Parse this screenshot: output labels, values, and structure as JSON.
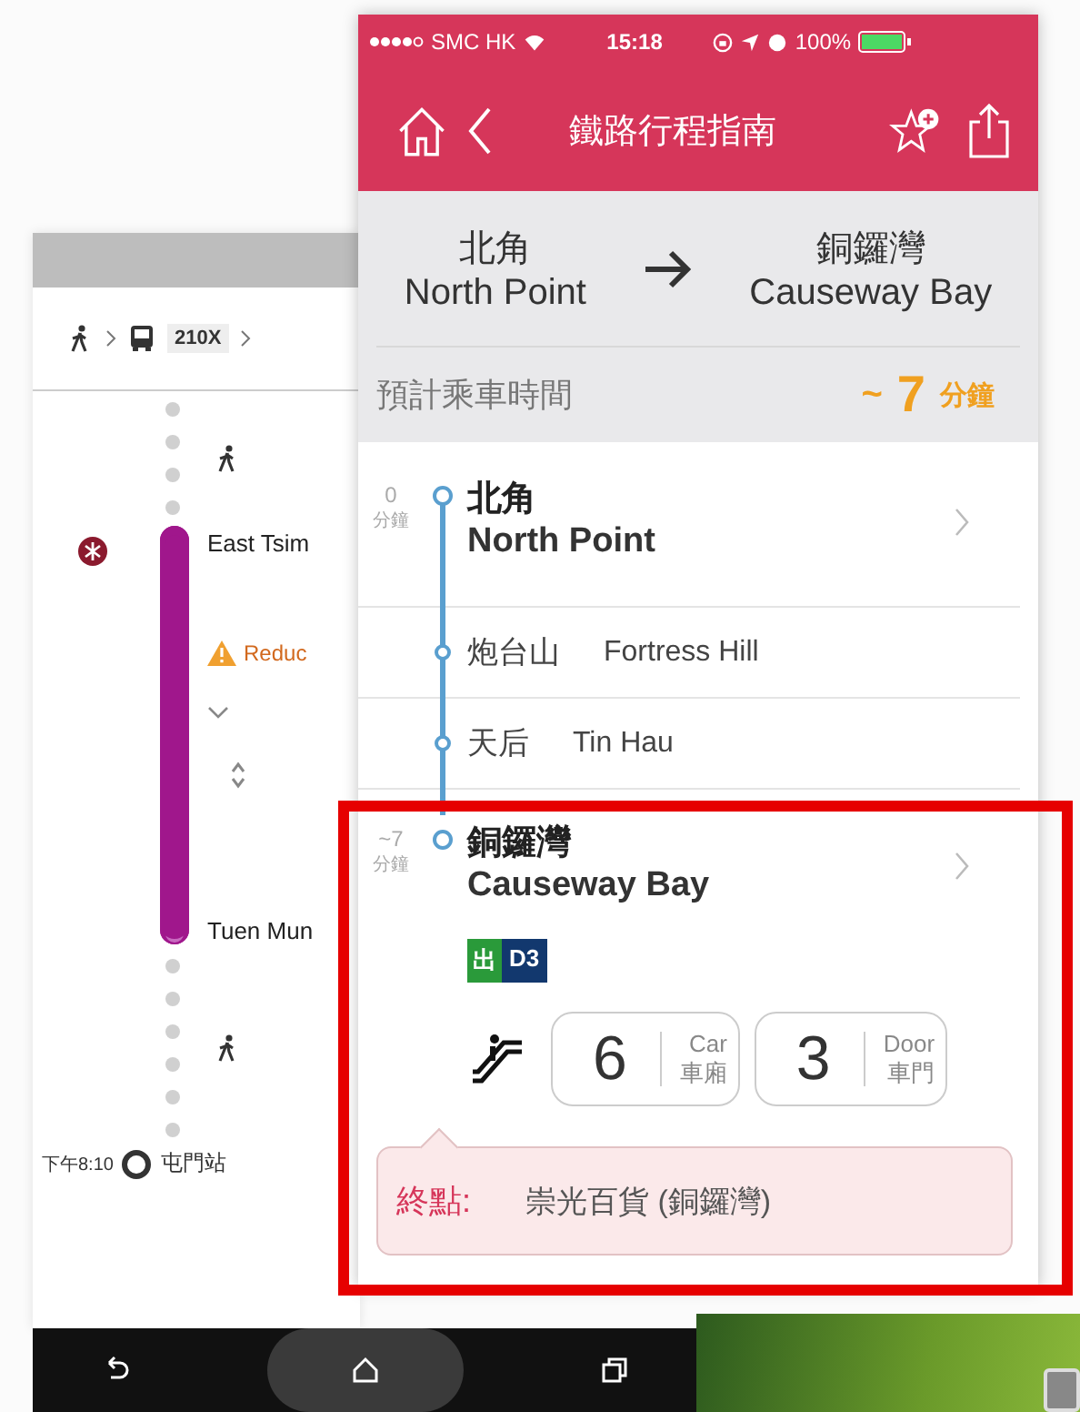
{
  "back_screen": {
    "route_bus": "210X",
    "stops": [
      {
        "kind": "station",
        "name": "East Tsim"
      },
      {
        "kind": "alert",
        "text": "Reduc"
      },
      {
        "kind": "station",
        "name": "Tuen Mun"
      },
      {
        "kind": "end",
        "time": "下午8:10",
        "name": "屯門站"
      }
    ]
  },
  "status_bar": {
    "carrier": "SMC HK",
    "time": "15:18",
    "battery": "100%"
  },
  "title": "鐵路行程指南",
  "route": {
    "from": {
      "zh": "北角",
      "en": "North Point"
    },
    "to": {
      "zh": "銅鑼灣",
      "en": "Causeway Bay"
    }
  },
  "travel_time": {
    "label": "預計乘車時間",
    "prefix": "~",
    "value": "7",
    "unit": "分鐘"
  },
  "stops": [
    {
      "kind": "major",
      "minutes": "0",
      "minutes_unit": "分鐘",
      "zh": "北角",
      "en": "North Point"
    },
    {
      "kind": "minor",
      "zh": "炮台山",
      "en": "Fortress Hill"
    },
    {
      "kind": "minor",
      "zh": "天后",
      "en": "Tin Hau"
    },
    {
      "kind": "major",
      "minutes": "~7",
      "minutes_unit": "分鐘",
      "zh": "銅鑼灣",
      "en": "Causeway Bay"
    }
  ],
  "exit": {
    "icon_text": "出",
    "code": "D3"
  },
  "boarding": [
    {
      "number": "6",
      "en": "Car",
      "zh": "車廂"
    },
    {
      "number": "3",
      "en": "Door",
      "zh": "車門"
    }
  ],
  "destination": {
    "label": "終點:",
    "name": "崇光百貨 (銅鑼灣)"
  }
}
